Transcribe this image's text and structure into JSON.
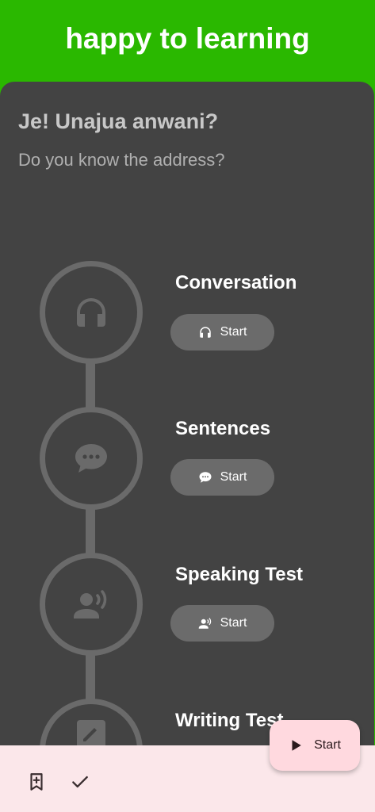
{
  "app_bar": {
    "title": "happy to learning"
  },
  "lesson": {
    "title": "Je! Unajua anwani?",
    "subtitle": "Do you know the address?"
  },
  "steps": [
    {
      "title": "Conversation",
      "button_label": "Start",
      "icon": "headphones-icon"
    },
    {
      "title": "Sentences",
      "button_label": "Start",
      "icon": "chat-bubble-icon"
    },
    {
      "title": "Speaking Test",
      "button_label": "Start",
      "icon": "speaking-person-icon"
    },
    {
      "title": "Writing Test",
      "icon": "edit-icon"
    }
  ],
  "fab": {
    "label": "Start",
    "icon": "play-icon"
  },
  "bottom_bar": {
    "icons": [
      "bookmark-add-icon",
      "check-icon"
    ]
  },
  "colors": {
    "app_bar": "#2ab800",
    "card": "#434343",
    "timeline": "#6a6a6a",
    "bottom_bar": "#fbe7ea",
    "fab": "#ffd9df"
  }
}
